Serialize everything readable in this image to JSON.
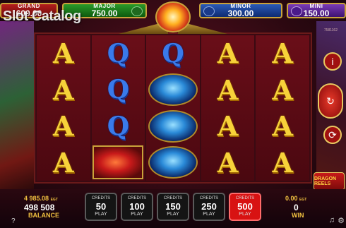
{
  "watermark": "Slot Catalog",
  "jackpots": {
    "grand": {
      "name": "GRAND",
      "value": "600.00"
    },
    "major": {
      "name": "MAJOR",
      "value": "750.00"
    },
    "minor": {
      "name": "MINOR",
      "value": "300.00"
    },
    "mini": {
      "name": "MINI",
      "value": "150.00"
    }
  },
  "game_id": "7581162",
  "reels": [
    [
      "A",
      "A",
      "A",
      "A"
    ],
    [
      "Q",
      "Q",
      "Q",
      "red-dragon"
    ],
    [
      "Q",
      "blue-dragon",
      "blue-dragon",
      "blue-dragon"
    ],
    [
      "A",
      "A",
      "A",
      "A"
    ],
    [
      "A",
      "A",
      "A",
      "A"
    ]
  ],
  "balance": {
    "secondary_value": "4 985.08",
    "secondary_unit": "EGT",
    "credits": "498 508",
    "label": "BALANCE"
  },
  "bets": [
    {
      "label": "CREDITS",
      "value": "50",
      "play": "PLAY",
      "active": false
    },
    {
      "label": "CREDITS",
      "value": "100",
      "play": "PLAY",
      "active": false
    },
    {
      "label": "CREDITS",
      "value": "150",
      "play": "PLAY",
      "active": false
    },
    {
      "label": "CREDITS",
      "value": "250",
      "play": "PLAY",
      "active": false
    },
    {
      "label": "CREDITS",
      "value": "500",
      "play": "PLAY",
      "active": true
    }
  ],
  "win": {
    "secondary_value": "0.00",
    "secondary_unit": "EGT",
    "credits": "0",
    "label": "WIN"
  },
  "logo_text": "DRAGON REELS",
  "icons": {
    "help": "?",
    "music": "♫",
    "settings": "⚙",
    "info": "i",
    "spin": "↻",
    "autoplay": "⟳"
  }
}
